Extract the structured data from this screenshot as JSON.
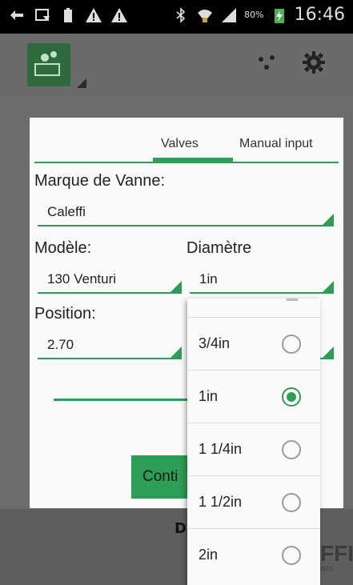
{
  "status_bar": {
    "battery_percent": "80%",
    "time": "16:46",
    "icons": [
      "usb-icon",
      "screen-icon",
      "battery-small-icon",
      "warning-icon",
      "warning-icon",
      "bluetooth-icon",
      "wifi-icon",
      "signal-icon",
      "battery-charging-icon"
    ]
  },
  "action_bar": {
    "icons": [
      "app-logo-icon",
      "water-drops-icon",
      "gear-icon"
    ]
  },
  "dialog": {
    "tabs": [
      {
        "label": "Valves",
        "selected": true
      },
      {
        "label": "Manual input",
        "selected": false
      }
    ],
    "brand_label": "Marque de Vanne:",
    "brand_value": "Caleffi",
    "model_label": "Modèle:",
    "model_value": "130 Venturi",
    "diameter_label": "Diamètre",
    "diameter_value": "1in",
    "position_label": "Position:",
    "position_value": "2.70",
    "slider_level": 0.55,
    "continue_label": "Conti"
  },
  "dropdown": {
    "options": [
      {
        "label": "3/4in",
        "selected": false
      },
      {
        "label": "1in",
        "selected": true
      },
      {
        "label": "1 1/4in",
        "selected": false
      },
      {
        "label": "1 1/2in",
        "selected": false
      },
      {
        "label": "2in",
        "selected": false
      }
    ]
  },
  "background": {
    "bottom_text": "DI",
    "brand_text": "FFI",
    "brand_sub": "lists"
  },
  "colors": {
    "accent": "#2e9d55",
    "status_bar": "#000000",
    "dim": "#6b6b6b"
  }
}
